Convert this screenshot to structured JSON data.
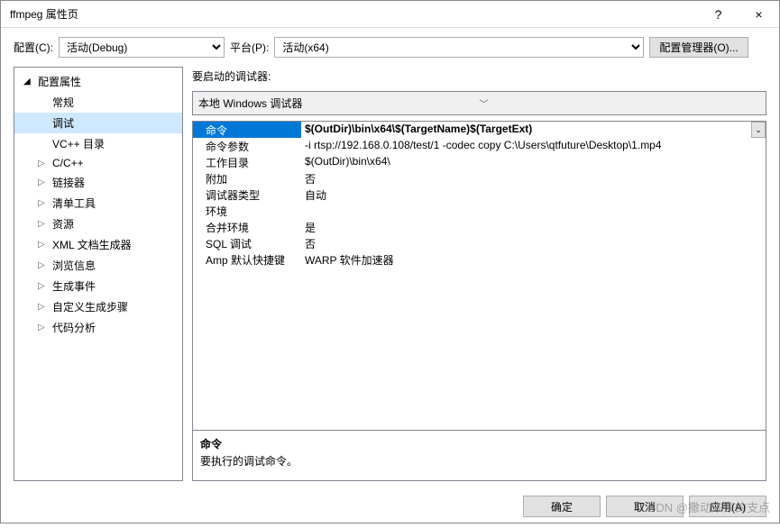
{
  "window": {
    "title": "ffmpeg 属性页",
    "help": "?",
    "close": "×"
  },
  "toolbar": {
    "config_label": "配置(C):",
    "config_value": "活动(Debug)",
    "platform_label": "平台(P):",
    "platform_value": "活动(x64)",
    "config_mgr": "配置管理器(O)..."
  },
  "tree": {
    "root": "配置属性",
    "items": [
      {
        "label": "常规",
        "indent": 40,
        "caret": ""
      },
      {
        "label": "调试",
        "indent": 40,
        "caret": "",
        "selected": true
      },
      {
        "label": "VC++ 目录",
        "indent": 40,
        "caret": ""
      },
      {
        "label": "C/C++",
        "indent": 26,
        "caret": "▷"
      },
      {
        "label": "链接器",
        "indent": 26,
        "caret": "▷"
      },
      {
        "label": "清单工具",
        "indent": 26,
        "caret": "▷"
      },
      {
        "label": "资源",
        "indent": 26,
        "caret": "▷"
      },
      {
        "label": "XML 文档生成器",
        "indent": 26,
        "caret": "▷"
      },
      {
        "label": "浏览信息",
        "indent": 26,
        "caret": "▷"
      },
      {
        "label": "生成事件",
        "indent": 26,
        "caret": "▷"
      },
      {
        "label": "自定义生成步骤",
        "indent": 26,
        "caret": "▷"
      },
      {
        "label": "代码分析",
        "indent": 26,
        "caret": "▷"
      }
    ]
  },
  "right": {
    "label": "要启动的调试器:",
    "debugger": "本地 Windows 调试器",
    "rows": [
      {
        "name": "命令",
        "value": "$(OutDir)\\bin\\x64\\$(TargetName)$(TargetExt)",
        "selected": true
      },
      {
        "name": "命令参数",
        "value": "-i rtsp://192.168.0.108/test/1 -codec copy C:\\Users\\qtfuture\\Desktop\\1.mp4"
      },
      {
        "name": "工作目录",
        "value": "$(OutDir)\\bin\\x64\\"
      },
      {
        "name": "附加",
        "value": "否"
      },
      {
        "name": "调试器类型",
        "value": "自动"
      },
      {
        "name": "环境",
        "value": ""
      },
      {
        "name": "合并环境",
        "value": "是"
      },
      {
        "name": "SQL 调试",
        "value": "否"
      },
      {
        "name": "Amp 默认快捷键",
        "value": "WARP 软件加速器"
      }
    ],
    "desc": {
      "title": "命令",
      "text": "要执行的调试命令。"
    }
  },
  "footer": {
    "ok": "确定",
    "cancel": "取消",
    "apply": "应用(A)"
  },
  "watermark": "CSDN @撒动未来的支点"
}
